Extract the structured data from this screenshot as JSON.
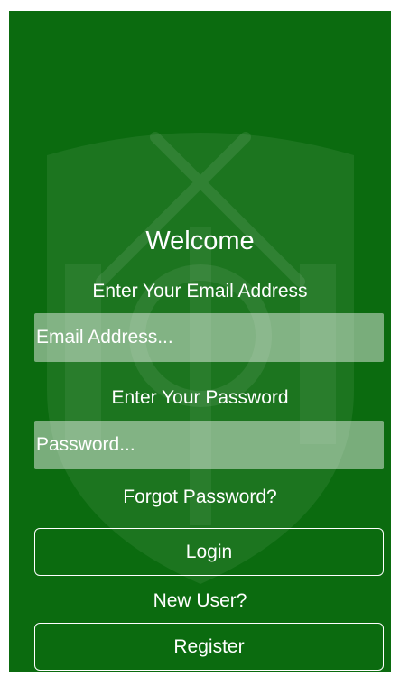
{
  "theme": {
    "background": "#0b6b0f",
    "text": "#ffffff"
  },
  "header": {
    "title": "Welcome"
  },
  "email": {
    "label": "Enter Your Email Address",
    "placeholder": "Email Address...",
    "value": ""
  },
  "password": {
    "label": "Enter Your Password",
    "placeholder": "Password...",
    "value": ""
  },
  "links": {
    "forgot_password": "Forgot Password?",
    "new_user": "New User?"
  },
  "buttons": {
    "login": "Login",
    "register": "Register"
  },
  "background_graphic": "crest-watermark-icon"
}
